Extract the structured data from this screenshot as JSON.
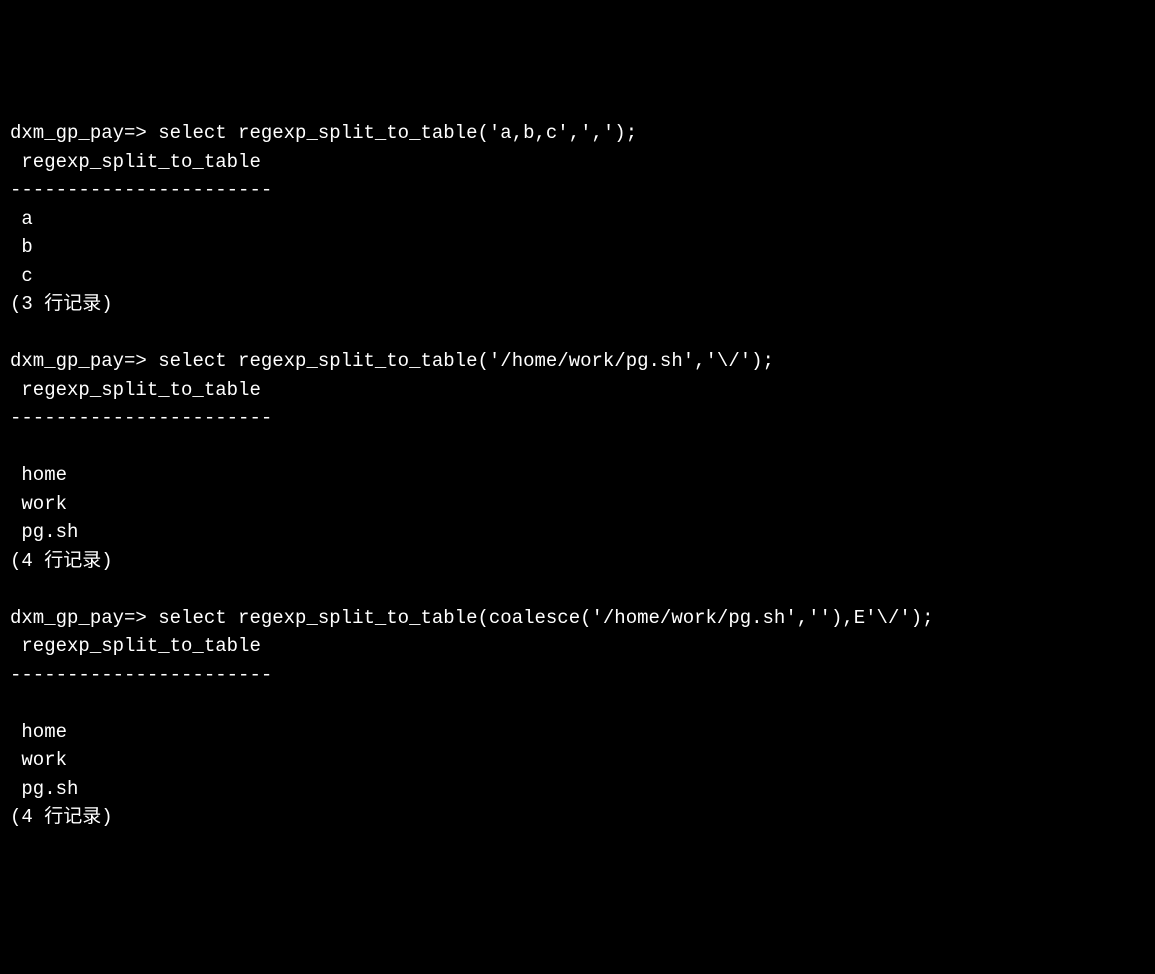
{
  "queries": [
    {
      "prompt": "dxm_gp_pay=> ",
      "command": "select regexp_split_to_table('a,b,c',',');",
      "header": " regexp_split_to_table ",
      "separator": "-----------------------",
      "rows": [
        " a",
        " b",
        " c"
      ],
      "footer": "(3 行记录)"
    },
    {
      "prompt": "dxm_gp_pay=> ",
      "command": "select regexp_split_to_table('/home/work/pg.sh','\\/');",
      "header": " regexp_split_to_table ",
      "separator": "-----------------------",
      "rows": [
        " ",
        " home",
        " work",
        " pg.sh"
      ],
      "footer": "(4 行记录)"
    },
    {
      "prompt": "dxm_gp_pay=> ",
      "command": "select regexp_split_to_table(coalesce('/home/work/pg.sh',''),E'\\/');",
      "header": " regexp_split_to_table ",
      "separator": "-----------------------",
      "rows": [
        " ",
        " home",
        " work",
        " pg.sh"
      ],
      "footer": "(4 行记录)"
    }
  ]
}
